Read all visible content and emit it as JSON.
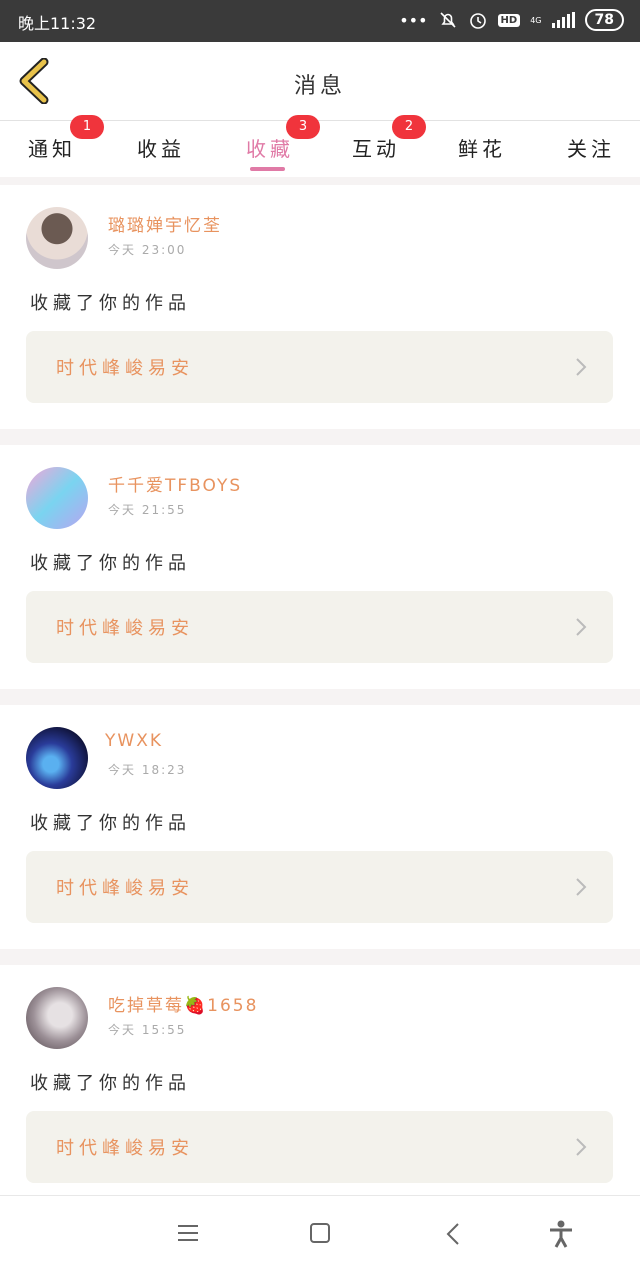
{
  "status_bar": {
    "time": "晚上11:32",
    "dots": "•••",
    "hd": "HD",
    "network": "4G",
    "battery": "78"
  },
  "header": {
    "title": "消息"
  },
  "tabs": [
    {
      "label": "通知",
      "badge": "1"
    },
    {
      "label": "收益",
      "badge": ""
    },
    {
      "label": "收藏",
      "badge": "3",
      "active": true
    },
    {
      "label": "互动",
      "badge": "2"
    },
    {
      "label": "鲜花",
      "badge": ""
    },
    {
      "label": "关注",
      "badge": ""
    }
  ],
  "messages": [
    {
      "username": "璐璐婵宇忆荃",
      "time": "今天 23:00",
      "text": "收藏了你的作品",
      "work_title": "时代峰峻易安"
    },
    {
      "username": "千千爱TFBOYS",
      "time": "今天 21:55",
      "text": "收藏了你的作品",
      "work_title": "时代峰峻易安"
    },
    {
      "username": "YWXK",
      "time": "今天 18:23",
      "text": "收藏了你的作品",
      "work_title": "时代峰峻易安"
    },
    {
      "username": "吃掉草莓🍓1658",
      "time": "今天 15:55",
      "text": "收藏了你的作品",
      "work_title": "时代峰峻易安"
    }
  ],
  "colors": {
    "accent": "#e07aa6",
    "name": "#e8935f",
    "badge": "#f0343c",
    "back_icon": "#e8c24a"
  }
}
